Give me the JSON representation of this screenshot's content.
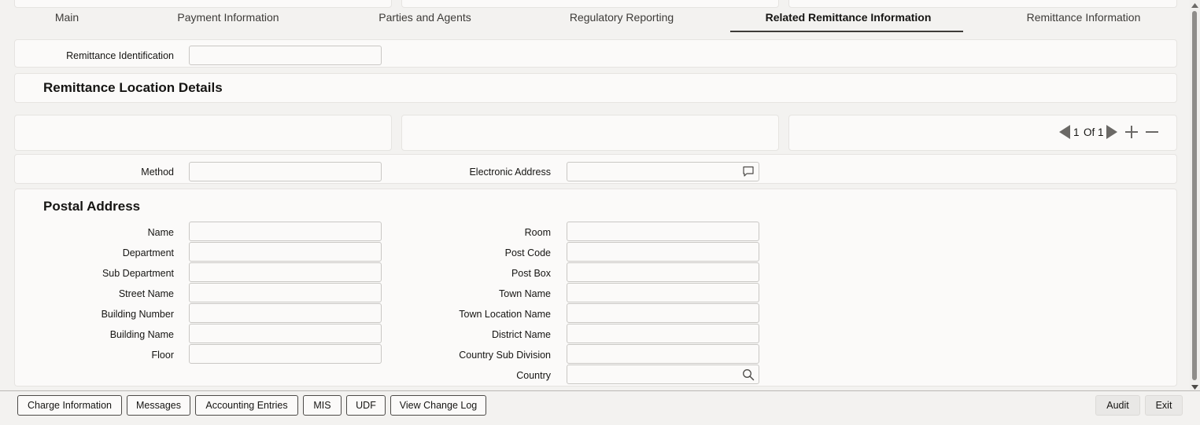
{
  "tabs": [
    {
      "label": "Main"
    },
    {
      "label": "Payment Information"
    },
    {
      "label": "Parties and Agents"
    },
    {
      "label": "Regulatory Reporting"
    },
    {
      "label": "Related Remittance Information"
    },
    {
      "label": "Remittance Information"
    }
  ],
  "active_tab": "Related Remittance Information",
  "remittance": {
    "identification_label": "Remittance Identification",
    "identification_value": ""
  },
  "location": {
    "title": "Remittance Location Details",
    "pager": {
      "current": "1",
      "of_label": "Of",
      "total": "1"
    },
    "method_label": "Method",
    "method_value": "",
    "electronic_address_label": "Electronic Address",
    "electronic_address_value": ""
  },
  "postal": {
    "title": "Postal Address",
    "left_fields": [
      {
        "label": "Name",
        "value": ""
      },
      {
        "label": "Department",
        "value": ""
      },
      {
        "label": "Sub Department",
        "value": ""
      },
      {
        "label": "Street Name",
        "value": ""
      },
      {
        "label": "Building Number",
        "value": ""
      },
      {
        "label": "Building Name",
        "value": ""
      },
      {
        "label": "Floor",
        "value": ""
      }
    ],
    "right_fields": [
      {
        "label": "Room",
        "value": ""
      },
      {
        "label": "Post Code",
        "value": ""
      },
      {
        "label": "Post Box",
        "value": ""
      },
      {
        "label": "Town Name",
        "value": ""
      },
      {
        "label": "Town Location Name",
        "value": ""
      },
      {
        "label": "District Name",
        "value": ""
      },
      {
        "label": "Country Sub Division",
        "value": ""
      },
      {
        "label": "Country",
        "value": ""
      }
    ]
  },
  "footer": {
    "buttons": [
      {
        "label": "Charge Information"
      },
      {
        "label": "Messages"
      },
      {
        "label": "Accounting Entries"
      },
      {
        "label": "MIS"
      },
      {
        "label": "UDF"
      },
      {
        "label": "View Change Log"
      }
    ],
    "audit_label": "Audit",
    "exit_label": "Exit"
  },
  "colors": {
    "accent": "#3d3b38",
    "panel": "#fbfaf9",
    "background": "#f3f2f0"
  }
}
